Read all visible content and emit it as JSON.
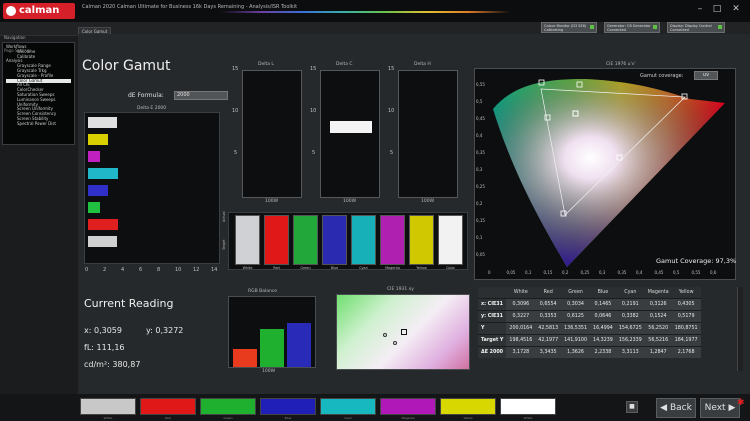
{
  "window": {
    "app_name": "calman",
    "title": "Calman 2020 Calman Ultimate for Business 16k Days Remaining - Analysis/ISR Toolkit",
    "minimize": "–",
    "maximize": "□",
    "close": "✕"
  },
  "toolbar": {
    "devices": [
      {
        "label": "Colour Monitor (D3 SE6)",
        "sub": "Calibrating"
      },
      {
        "label": "Generator: C6 Generator",
        "sub": "Connected"
      },
      {
        "label": "Display: Display Control",
        "sub": "Connected"
      }
    ]
  },
  "sidebar": {
    "header": "Navigation",
    "sub": "Page Settings",
    "items": [
      {
        "label": "Workflows",
        "level": 0
      },
      {
        "label": "Welcome",
        "level": 1
      },
      {
        "label": "Calibrate",
        "level": 1
      },
      {
        "label": "Analysis",
        "level": 0
      },
      {
        "label": "Grayscale Range",
        "level": 1
      },
      {
        "label": "Grayscale Trkg",
        "level": 1
      },
      {
        "label": "Grayscale - Profile",
        "level": 1
      },
      {
        "label": "Color Gamut",
        "level": 1,
        "active": true
      },
      {
        "label": "All CIE",
        "level": 1
      },
      {
        "label": "ColorChecker",
        "level": 1
      },
      {
        "label": "Saturation Sweeps",
        "level": 1
      },
      {
        "label": "Luminance Sweeps",
        "level": 1
      },
      {
        "label": "Uniformity",
        "level": 1
      },
      {
        "label": "Screen Uniformity",
        "level": 1
      },
      {
        "label": "Screen Consistency",
        "level": 1
      },
      {
        "label": "Screen Stability",
        "level": 1
      },
      {
        "label": "Spectral Power Dist",
        "level": 1
      }
    ]
  },
  "tab": {
    "label": "Color Gamut"
  },
  "page": {
    "title": "Color Gamut",
    "df_label": "dE Formula:",
    "df_value": "2000"
  },
  "charts": {
    "de_hbar": {
      "title": "Delta E 2000",
      "x_ticks": [
        "0",
        "2",
        "4",
        "6",
        "8",
        "10",
        "12",
        "14"
      ],
      "bars": [
        {
          "color": "#e0e0e0",
          "value": 3.1728
        },
        {
          "color": "#d8d000",
          "value": 2.1768
        },
        {
          "color": "#c020c0",
          "value": 1.2847
        },
        {
          "color": "#20b8c8",
          "value": 3.3113
        },
        {
          "color": "#3030c8",
          "value": 2.2338
        },
        {
          "color": "#20c040",
          "value": 1.3626
        },
        {
          "color": "#e02020",
          "value": 3.3435
        },
        {
          "color": "#d0d0d0",
          "value": 3.1728
        }
      ]
    },
    "delta_l": {
      "title": "Delta L",
      "y_ticks": [
        "15",
        "10",
        "5"
      ],
      "footer": "100W"
    },
    "delta_c": {
      "title": "Delta C",
      "y_ticks": [
        "15",
        "10",
        "5"
      ],
      "footer": "100W"
    },
    "delta_h": {
      "title": "Delta H",
      "y_ticks": [
        "15",
        "10",
        "5"
      ],
      "footer": "100W"
    },
    "luminance": {
      "title": "RGB Balance",
      "footer": "100W"
    },
    "cie_small": {
      "title": "CIE 1931 xy"
    },
    "cie_large": {
      "title": "CIE 1976 u'v'",
      "gamut_label": "Gamut coverage:",
      "gamut_value": "uv",
      "coverage_text": "Gamut Coverage:  97,3%",
      "y_ticks": [
        "0,55",
        "0,5",
        "0,45",
        "0,4",
        "0,35",
        "0,3",
        "0,25",
        "0,2",
        "0,15",
        "0,1",
        "0,05"
      ],
      "x_ticks": [
        "0",
        "0,05",
        "0,1",
        "0,15",
        "0,2",
        "0,25",
        "0,3",
        "0,35",
        "0,4",
        "0,45",
        "0,5",
        "0,55",
        "0,6"
      ]
    }
  },
  "patches": {
    "side_label_top": "Actual",
    "side_label_bottom": "Target",
    "items": [
      {
        "label": "White",
        "color": "#cfd1d4"
      },
      {
        "label": "Red",
        "color": "#e01818"
      },
      {
        "label": "Green",
        "color": "#22a83a"
      },
      {
        "label": "Blue",
        "color": "#2a2ab0"
      },
      {
        "label": "Cyan",
        "color": "#18b0b8"
      },
      {
        "label": "Magenta",
        "color": "#b020b0"
      },
      {
        "label": "Yellow",
        "color": "#d0c800"
      },
      {
        "label": "Color",
        "color": "#f2f2f2"
      }
    ]
  },
  "current_reading": {
    "title": "Current Reading",
    "x": "x: 0,3059",
    "y": "y: 0,3272",
    "fl": "fL: 111,16",
    "cdm2": "cd/m²: 380,87"
  },
  "table": {
    "headers": [
      "",
      "White",
      "Red",
      "Green",
      "Blue",
      "Cyan",
      "Magenta",
      "Yellow"
    ],
    "rows": [
      [
        "x: CIE31",
        "0,3096",
        "0,6554",
        "0,3034",
        "0,1465",
        "0,2191",
        "0,3126",
        "0,4305"
      ],
      [
        "y: CIE31",
        "0,3227",
        "0,3353",
        "0,6125",
        "0,0646",
        "0,3382",
        "0,1524",
        "0,5179"
      ],
      [
        "Y",
        "200,0164",
        "42,5813",
        "136,5351",
        "16,4994",
        "154,6725",
        "56,2520",
        "180,8751"
      ],
      [
        "Target Y",
        "198,4516",
        "42,1977",
        "141,9100",
        "14,3239",
        "156,2339",
        "56,5216",
        "184,1977"
      ],
      [
        "ΔE 2000",
        "3,1728",
        "3,3435",
        "1,3626",
        "2,2338",
        "3,3113",
        "1,2847",
        "2,1768"
      ]
    ]
  },
  "bottom": {
    "swatches": [
      {
        "label": "White",
        "color": "#c8c8c8"
      },
      {
        "label": "Red",
        "color": "#e01818"
      },
      {
        "label": "Green",
        "color": "#20b030"
      },
      {
        "label": "Blue",
        "color": "#2020b8"
      },
      {
        "label": "Cyan",
        "color": "#18b8c0"
      },
      {
        "label": "Magenta",
        "color": "#b018b8"
      },
      {
        "label": "Yellow",
        "color": "#d8d800"
      },
      {
        "label": "White",
        "color": "#ffffff"
      }
    ],
    "back_label": "Back",
    "next_label": "Next"
  }
}
